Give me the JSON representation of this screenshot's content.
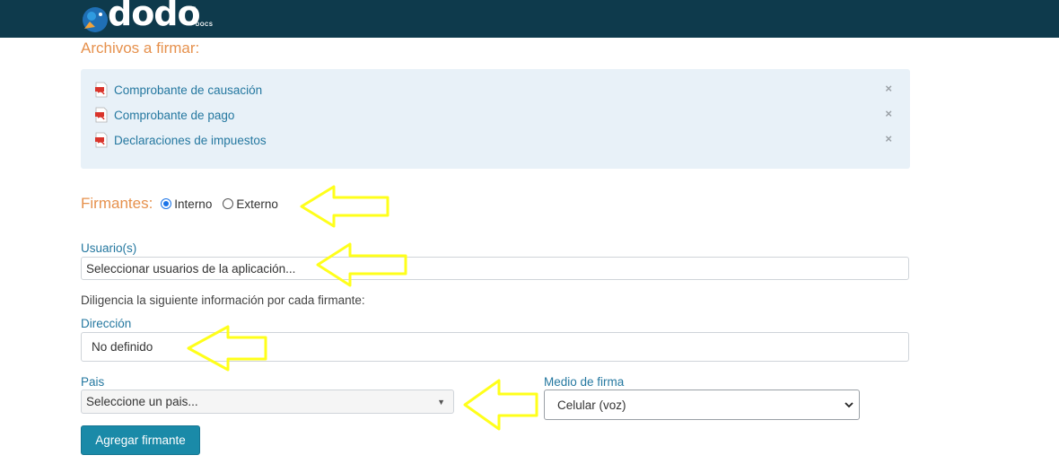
{
  "header": {
    "logo_word": "dodo",
    "logo_sub": "DOCS",
    "logo_reg": "®"
  },
  "files": {
    "title": "Archivos a firmar:",
    "items": [
      {
        "name": "Comprobante de causación",
        "icon": "pdf-icon"
      },
      {
        "name": "Comprobante de pago",
        "icon": "pdf-icon"
      },
      {
        "name": "Declaraciones de impuestos",
        "icon": "pdf-icon"
      }
    ],
    "remove_symbol": "×"
  },
  "signers": {
    "label": "Firmantes:",
    "options": [
      {
        "label": "Interno",
        "checked": true
      },
      {
        "label": "Externo",
        "checked": false
      }
    ]
  },
  "users": {
    "label": "Usuario(s)",
    "placeholder": "Seleccionar usuarios de la aplicación..."
  },
  "info_text": "Diligencia la siguiente información por cada firmante:",
  "address": {
    "label": "Dirección",
    "value": "No definido"
  },
  "country": {
    "label": "Pais",
    "selected": "Seleccione un pais..."
  },
  "signing_method": {
    "label": "Medio de firma",
    "selected": "Celular (voz)"
  },
  "add_button": {
    "label": "Agregar firmante"
  },
  "colors": {
    "header_bg": "#0e3a4c",
    "accent_orange": "#e6914d",
    "label_blue": "#2578a0",
    "button_bg": "#1a8aa8",
    "annotation_arrow": "#ffff1a"
  }
}
